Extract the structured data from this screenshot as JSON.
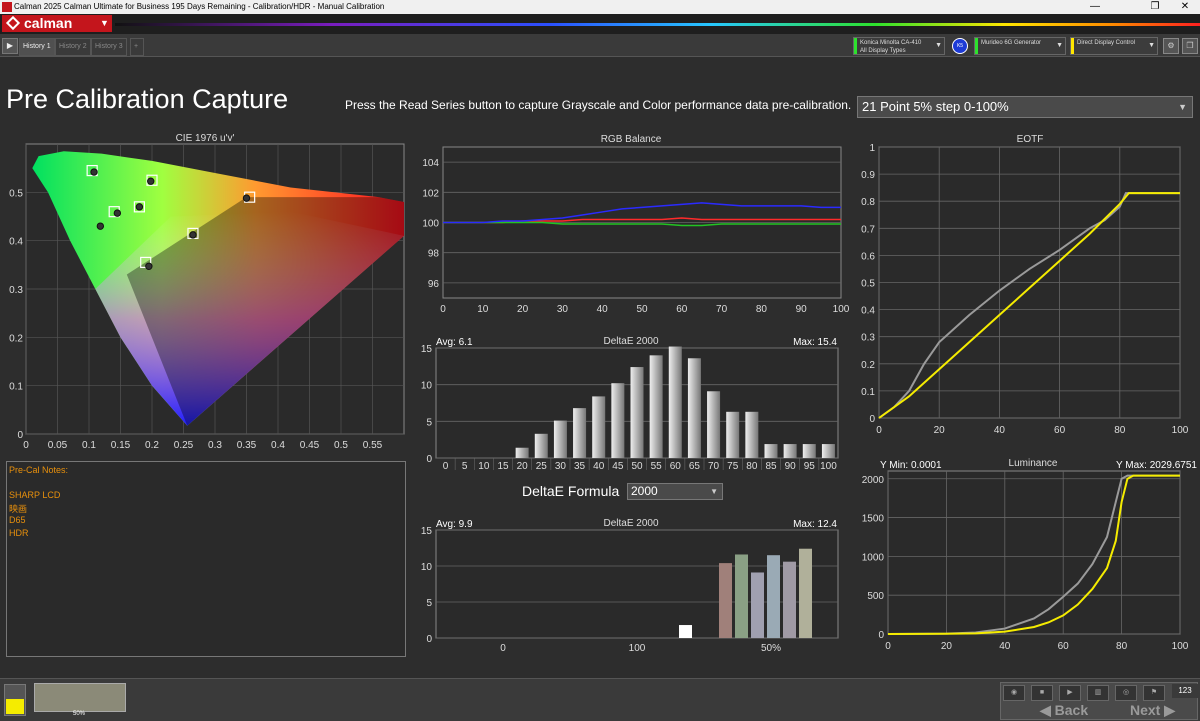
{
  "window": {
    "title": "Calman 2025 Calman Ultimate for Business 195 Days Remaining  - Calibration/HDR - Manual Calibration",
    "min_glyph": "—",
    "max_glyph": "❐",
    "close_glyph": "✕"
  },
  "brand": {
    "label": "calman",
    "dropdown": "▼"
  },
  "tabs": [
    {
      "label": "History 1",
      "active": true
    },
    {
      "label": "History 2",
      "active": false
    },
    {
      "label": "History 3",
      "active": false
    }
  ],
  "toolbar": {
    "play": "▶",
    "add_tab": "+",
    "meter": {
      "line1": "Konica Minolta CA-410",
      "line2": "All Display Types",
      "color": "#2de22d"
    },
    "meter_badge": "K5",
    "generator": {
      "line1": "Murideo 6G Generator",
      "color": "#2de22d"
    },
    "display": {
      "line1": "Direct Display Control",
      "color": "#ffe600"
    },
    "settings_glyph": "⚙",
    "expand_glyph": "❐"
  },
  "header": {
    "title": "Pre Calibration Capture",
    "instruction": "Press the Read Series button to capture Grayscale and Color performance data pre-calibration.",
    "series_option": "21 Point 5% step 0-100%"
  },
  "cie": {
    "title": "CIE 1976 u'v'",
    "x_ticks": [
      "0",
      "0.05",
      "0.1",
      "0.15",
      "0.2",
      "0.25",
      "0.3",
      "0.35",
      "0.4",
      "0.45",
      "0.5",
      "0.55"
    ],
    "y_ticks": [
      "0",
      "0.1",
      "0.2",
      "0.3",
      "0.4",
      "0.5"
    ]
  },
  "notes": {
    "title": "Pre-Cal Notes:",
    "lines": [
      "SHARP LCD",
      "映画",
      "D65",
      "HDR"
    ]
  },
  "rgb_balance": {
    "title": "RGB Balance",
    "x_ticks": [
      "0",
      "10",
      "20",
      "30",
      "40",
      "50",
      "60",
      "70",
      "80",
      "90",
      "100"
    ],
    "y_ticks": [
      "96",
      "98",
      "100",
      "102",
      "104"
    ]
  },
  "deltae_gray": {
    "title": "DeltaE 2000",
    "avg": "Avg: 6.1",
    "max": "Max: 15.4",
    "y_ticks": [
      "0",
      "5",
      "10",
      "15"
    ],
    "x_ticks": [
      "0",
      "5",
      "10",
      "15",
      "20",
      "25",
      "30",
      "35",
      "40",
      "45",
      "50",
      "55",
      "60",
      "65",
      "70",
      "75",
      "80",
      "85",
      "90",
      "95",
      "100"
    ]
  },
  "formula": {
    "label": "DeltaE Formula",
    "value": "2000"
  },
  "deltae_color": {
    "title": "DeltaE 2000",
    "avg": "Avg: 9.9",
    "max": "Max: 12.4",
    "y_ticks": [
      "0",
      "5",
      "10",
      "15"
    ],
    "x_labels": [
      "0",
      "100",
      "50%"
    ]
  },
  "eotf": {
    "title": "EOTF",
    "x_ticks": [
      "0",
      "20",
      "40",
      "60",
      "80",
      "100"
    ],
    "y_ticks": [
      "0",
      "0.1",
      "0.2",
      "0.3",
      "0.4",
      "0.5",
      "0.6",
      "0.7",
      "0.8",
      "0.9",
      "1"
    ]
  },
  "luminance": {
    "title": "Luminance",
    "ymin": "Y Min: 0.0001",
    "ymax": "Y Max: 2029.6751",
    "x_ticks": [
      "0",
      "20",
      "40",
      "60",
      "80",
      "100"
    ],
    "y_ticks": [
      "0",
      "500",
      "1000",
      "1500",
      "2000"
    ]
  },
  "bottom": {
    "patch_label": "50%",
    "patch_color": "#8b8a78",
    "back": "◀ Back",
    "next": "Next ▶",
    "count": "123",
    "controls": [
      "■",
      "▶",
      "▥",
      "◎",
      "⚑"
    ]
  },
  "chart_data": [
    {
      "type": "scatter",
      "name": "cie",
      "title": "CIE 1976 u'v'",
      "xlim": [
        0,
        0.6
      ],
      "ylim": [
        0,
        0.6
      ],
      "targets": [
        [
          0.105,
          0.545
        ],
        [
          0.2,
          0.525
        ],
        [
          0.14,
          0.46
        ],
        [
          0.18,
          0.47
        ],
        [
          0.355,
          0.49
        ],
        [
          0.265,
          0.415
        ],
        [
          0.19,
          0.355
        ]
      ],
      "measured": [
        [
          0.108,
          0.542
        ],
        [
          0.198,
          0.523
        ],
        [
          0.145,
          0.457
        ],
        [
          0.118,
          0.43
        ],
        [
          0.18,
          0.47
        ],
        [
          0.35,
          0.488
        ],
        [
          0.265,
          0.412
        ],
        [
          0.195,
          0.347
        ]
      ]
    },
    {
      "type": "line",
      "name": "rgb_balance",
      "title": "RGB Balance",
      "xlim": [
        0,
        100
      ],
      "ylim": [
        95,
        105
      ],
      "x": [
        0,
        5,
        10,
        15,
        20,
        25,
        30,
        35,
        40,
        45,
        50,
        55,
        60,
        65,
        70,
        75,
        80,
        85,
        90,
        95,
        100
      ],
      "series": [
        {
          "color": "#ff2a2a",
          "values": [
            100,
            100,
            100,
            100,
            100.1,
            100.1,
            100.1,
            100.2,
            100.2,
            100.2,
            100.2,
            100.2,
            100.3,
            100.2,
            100.2,
            100.2,
            100.2,
            100.2,
            100.2,
            100.2,
            100.2
          ]
        },
        {
          "color": "#22c422",
          "values": [
            100,
            100,
            100,
            100,
            100,
            100,
            99.9,
            99.9,
            99.9,
            99.9,
            99.9,
            99.9,
            99.8,
            99.8,
            99.9,
            99.9,
            99.9,
            99.9,
            99.9,
            99.9,
            99.9
          ]
        },
        {
          "color": "#2a2aff",
          "values": [
            100,
            100,
            100,
            100.1,
            100.1,
            100.2,
            100.3,
            100.5,
            100.7,
            100.9,
            101,
            101.1,
            101.2,
            101.3,
            101.2,
            101.1,
            101.1,
            101.1,
            101.1,
            101,
            101
          ]
        }
      ]
    },
    {
      "type": "bar",
      "name": "deltae_gray",
      "title": "DeltaE 2000",
      "ylim": [
        0,
        15
      ],
      "categories": [
        "0",
        "5",
        "10",
        "15",
        "20",
        "25",
        "30",
        "35",
        "40",
        "45",
        "50",
        "55",
        "60",
        "65",
        "70",
        "75",
        "80",
        "85",
        "90",
        "95",
        "100"
      ],
      "values": [
        0,
        0,
        0,
        0,
        1.4,
        3.3,
        5.1,
        6.8,
        8.4,
        10.2,
        12.4,
        14.0,
        15.2,
        13.6,
        9.1,
        6.3,
        6.3,
        1.9,
        1.9,
        1.9,
        1.9
      ]
    },
    {
      "type": "bar",
      "name": "deltae_color",
      "title": "DeltaE 2000",
      "ylim": [
        0,
        15
      ],
      "values": [
        1.8,
        10.4,
        11.6,
        9.1,
        11.5,
        10.6,
        12.4
      ],
      "colors": [
        "#ffffff",
        "#a0807a",
        "#8aa085",
        "#a0a0b0",
        "#9aaab5",
        "#a09aa5",
        "#b0b09a"
      ]
    },
    {
      "type": "line",
      "name": "eotf",
      "title": "EOTF",
      "xlim": [
        0,
        100
      ],
      "ylim": [
        0,
        1
      ],
      "series": [
        {
          "color": "#9a9a9a",
          "points": [
            [
              0,
              0
            ],
            [
              5,
              0.04
            ],
            [
              10,
              0.1
            ],
            [
              15,
              0.2
            ],
            [
              20,
              0.28
            ],
            [
              30,
              0.38
            ],
            [
              40,
              0.47
            ],
            [
              50,
              0.55
            ],
            [
              60,
              0.62
            ],
            [
              70,
              0.7
            ],
            [
              75,
              0.73
            ],
            [
              80,
              0.78
            ],
            [
              82,
              0.83
            ],
            [
              100,
              0.83
            ]
          ]
        },
        {
          "color": "#f5ec00",
          "points": [
            [
              0,
              0
            ],
            [
              10,
              0.08
            ],
            [
              20,
              0.18
            ],
            [
              30,
              0.28
            ],
            [
              40,
              0.38
            ],
            [
              50,
              0.48
            ],
            [
              60,
              0.58
            ],
            [
              70,
              0.68
            ],
            [
              80,
              0.79
            ],
            [
              83,
              0.83
            ],
            [
              100,
              0.83
            ]
          ]
        }
      ]
    },
    {
      "type": "line",
      "name": "luminance",
      "title": "Luminance",
      "xlim": [
        0,
        100
      ],
      "ylim": [
        0,
        2000
      ],
      "series": [
        {
          "color": "#9a9a9a",
          "points": [
            [
              0,
              0
            ],
            [
              20,
              5
            ],
            [
              30,
              20
            ],
            [
              40,
              70
            ],
            [
              50,
              200
            ],
            [
              55,
              320
            ],
            [
              60,
              480
            ],
            [
              65,
              650
            ],
            [
              70,
              900
            ],
            [
              75,
              1250
            ],
            [
              78,
              1700
            ],
            [
              80,
              2000
            ],
            [
              82,
              2040
            ],
            [
              100,
              2040
            ]
          ]
        },
        {
          "color": "#f5ec00",
          "points": [
            [
              0,
              0
            ],
            [
              20,
              3
            ],
            [
              30,
              8
            ],
            [
              40,
              30
            ],
            [
              50,
              90
            ],
            [
              55,
              150
            ],
            [
              60,
              240
            ],
            [
              65,
              380
            ],
            [
              70,
              580
            ],
            [
              75,
              850
            ],
            [
              78,
              1200
            ],
            [
              80,
              1700
            ],
            [
              82,
              2000
            ],
            [
              84,
              2040
            ],
            [
              100,
              2040
            ]
          ]
        }
      ]
    }
  ]
}
